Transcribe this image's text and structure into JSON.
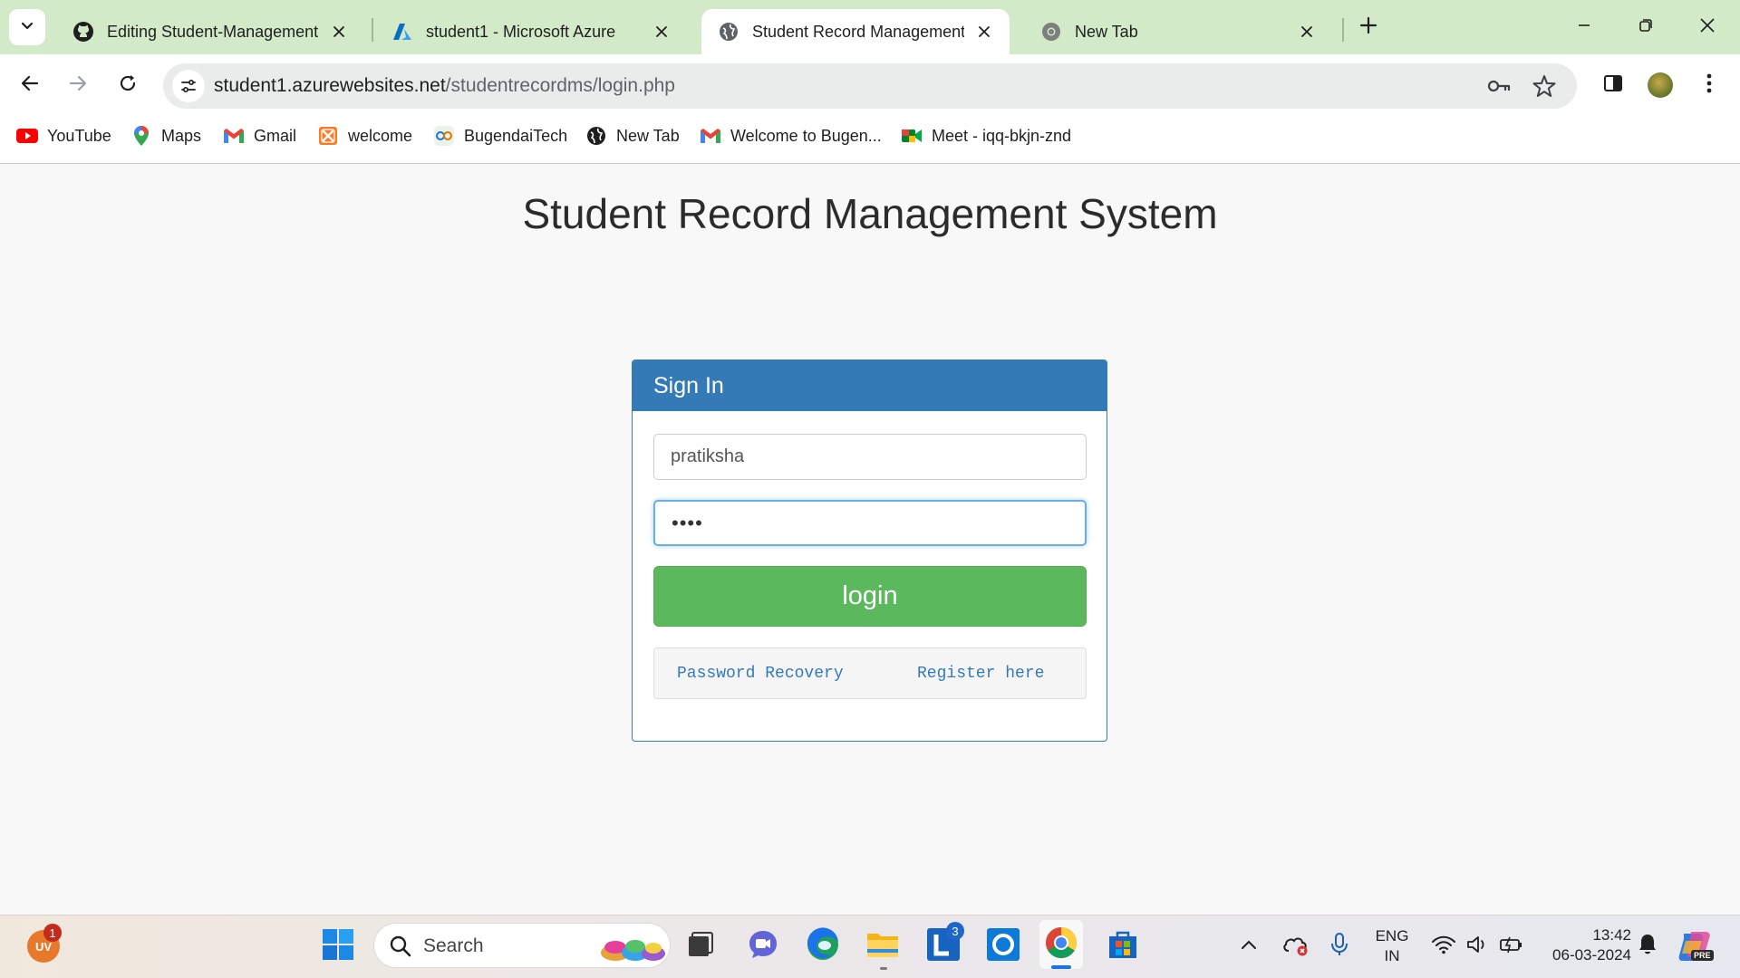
{
  "browser": {
    "tabs": [
      {
        "title": "Editing Student-Management-",
        "icon": "github-icon",
        "active": false
      },
      {
        "title": "student1 - Microsoft Azure",
        "icon": "azure-icon",
        "active": false
      },
      {
        "title": "Student Record Management Sy",
        "icon": "globe-icon",
        "active": true
      },
      {
        "title": "New Tab",
        "icon": "chrome-icon",
        "active": false
      }
    ],
    "url": {
      "host": "student1.azurewebsites.net",
      "path": "/studentrecordms/login.php"
    },
    "bookmarks": [
      {
        "label": "YouTube",
        "icon": "youtube-icon"
      },
      {
        "label": "Maps",
        "icon": "maps-icon"
      },
      {
        "label": "Gmail",
        "icon": "gmail-icon"
      },
      {
        "label": "welcome",
        "icon": "xampp-icon"
      },
      {
        "label": "BugendaiTech",
        "icon": "bugendaitech-icon"
      },
      {
        "label": "New Tab",
        "icon": "globe-icon"
      },
      {
        "label": "Welcome to Bugen...",
        "icon": "gmail-icon"
      },
      {
        "label": "Meet - iqq-bkjn-znd",
        "icon": "meet-icon"
      }
    ]
  },
  "page": {
    "title": "Student Record Management System",
    "panel": {
      "heading": "Sign In",
      "username_value": "pratiksha",
      "password_masked": "••••",
      "login_label": "login",
      "password_recovery_label": "Password Recovery",
      "register_label": "Register here"
    }
  },
  "taskbar": {
    "profile_initials": "UV",
    "profile_badge": "1",
    "search_label": "Search",
    "lync_badge": "3",
    "language": {
      "line1": "ENG",
      "line2": "IN"
    },
    "time": "13:42",
    "date": "06-03-2024",
    "copilot_tag": "PRE"
  },
  "colors": {
    "tabstrip": "#d3eac9",
    "panel_primary": "#337ab7",
    "login_green": "#5cb85c",
    "page_background": "#f8f8f8"
  }
}
